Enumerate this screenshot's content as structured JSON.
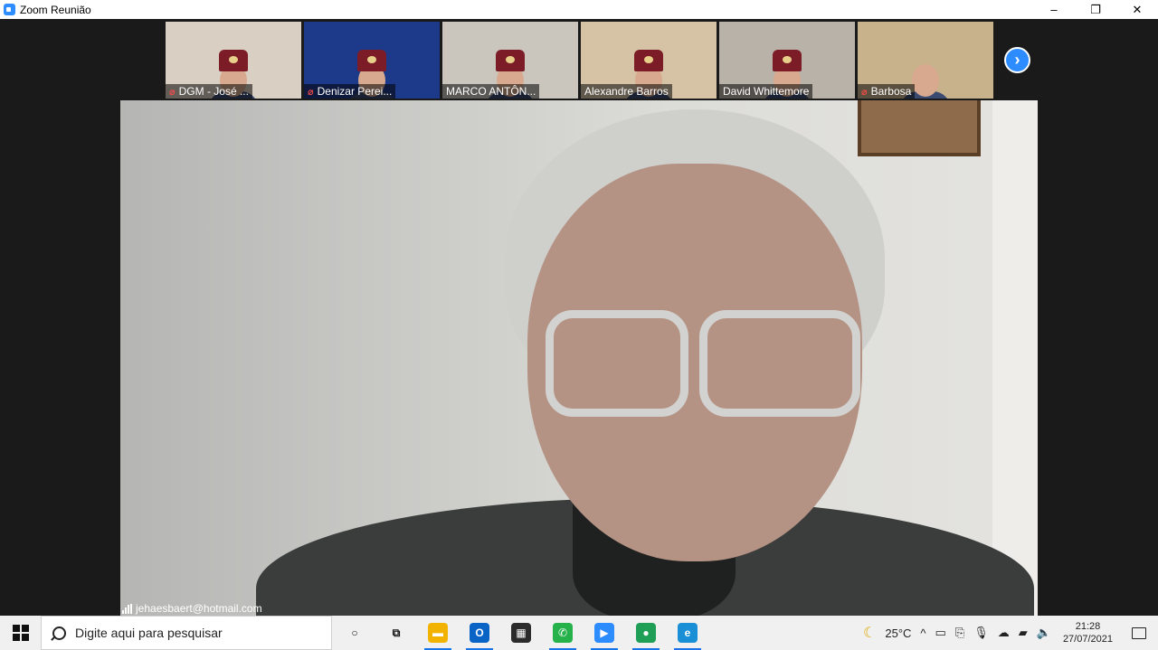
{
  "window": {
    "title": "Zoom Reunião",
    "minimize": "–",
    "restore": "❐",
    "close": "✕"
  },
  "participants": [
    {
      "name": "DGM - José ...",
      "muted": true,
      "bg": "#d9cfc2"
    },
    {
      "name": "Denizar Perei...",
      "muted": true,
      "bg": "#1d3a8a"
    },
    {
      "name": "MARCO ANTÔN...",
      "muted": false,
      "bg": "#cbc6bd"
    },
    {
      "name": "Alexandre Barros",
      "muted": false,
      "bg": "#d6c3a6"
    },
    {
      "name": "David Whittemore",
      "muted": false,
      "bg": "#b8b2a8"
    },
    {
      "name": "Barbosa",
      "muted": true,
      "bg": "#c7b28c"
    }
  ],
  "next_button": "›",
  "speaker": {
    "name": "jehaesbaert@hotmail.com"
  },
  "taskbar": {
    "search_placeholder": "Digite aqui para pesquisar",
    "apps": [
      {
        "icon": "cortana-icon",
        "glyph": "○",
        "color": "#f0f0f0",
        "text_color": "#111"
      },
      {
        "icon": "task-view-icon",
        "glyph": "⧉",
        "color": "#f0f0f0",
        "text_color": "#111"
      },
      {
        "icon": "file-explorer-icon",
        "glyph": "▬",
        "color": "#f2b200",
        "text_color": "#fff"
      },
      {
        "icon": "outlook-icon",
        "glyph": "O",
        "color": "#0a64c6",
        "text_color": "#fff"
      },
      {
        "icon": "store-icon",
        "glyph": "▦",
        "color": "#2b2b2b",
        "text_color": "#fff"
      },
      {
        "icon": "whatsapp-icon",
        "glyph": "✆",
        "color": "#25b24a",
        "text_color": "#fff"
      },
      {
        "icon": "zoom-icon",
        "glyph": "▶",
        "color": "#2d8cff",
        "text_color": "#fff"
      },
      {
        "icon": "meet-icon",
        "glyph": "●",
        "color": "#1f9e55",
        "text_color": "#fff"
      },
      {
        "icon": "edge-icon",
        "glyph": "e",
        "color": "#1a8fd6",
        "text_color": "#fff"
      }
    ],
    "weather": "25°C",
    "time": "21:28",
    "date": "27/07/2021"
  }
}
